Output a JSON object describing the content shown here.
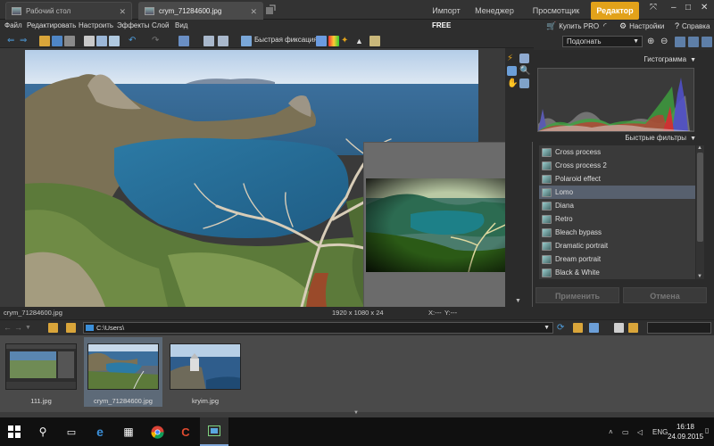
{
  "tabs": {
    "desktop": "Рабочий стол",
    "document": "crym_71284600.jpg"
  },
  "modes": [
    "Импорт",
    "Менеджер",
    "Просмотщик",
    "Редактор"
  ],
  "active_mode": "Редактор",
  "menu": [
    "Файл",
    "Редактировать",
    "Настроить",
    "Эффекты",
    "Слой",
    "Вид"
  ],
  "free_badge": "FREE",
  "right_links": {
    "buy": "Купить PRO",
    "settings": "Настройки",
    "help": "Справка"
  },
  "toolbar": {
    "quick_fix": "Быстрая фиксация"
  },
  "zoom": {
    "value": "Подогнать"
  },
  "panels": {
    "histogram_title": "Гистограмма",
    "filters_title": "Быстрые фильтры",
    "filters": [
      "Cross process",
      "Cross process 2",
      "Polaroid effect",
      "Lomo",
      "Diana",
      "Retro",
      "Bleach bypass",
      "Dramatic portrait",
      "Dream portrait",
      "Black & White"
    ],
    "selected_filter": "Lomo",
    "apply_label": "Применить",
    "cancel_label": "Отмена"
  },
  "status": {
    "filename": "crym_71284600.jpg",
    "dimensions": "1920 x 1080 x 24",
    "x_coord": "X:---",
    "y_coord": "Y:---"
  },
  "browser": {
    "path": "C:\\Users\\"
  },
  "thumbnails": [
    {
      "label": "111.jpg"
    },
    {
      "label": "crym_71284600.jpg"
    },
    {
      "label": "kryim.jpg"
    }
  ],
  "selected_thumbnail": "crym_71284600.jpg",
  "taskbar": {
    "language": "ENG",
    "time": "16:18",
    "date": "24.09.2015"
  },
  "colors": {
    "accent": "#e2a21a",
    "selection": "#57606e",
    "taskbar_highlight": "#7fa6d8"
  },
  "icons": [
    "search-icon",
    "task-view-icon",
    "edge-icon",
    "store-icon",
    "chrome-icon",
    "ccleaner-icon",
    "app-icon",
    "gear-icon",
    "cart-icon",
    "help-icon",
    "feed-icon"
  ]
}
